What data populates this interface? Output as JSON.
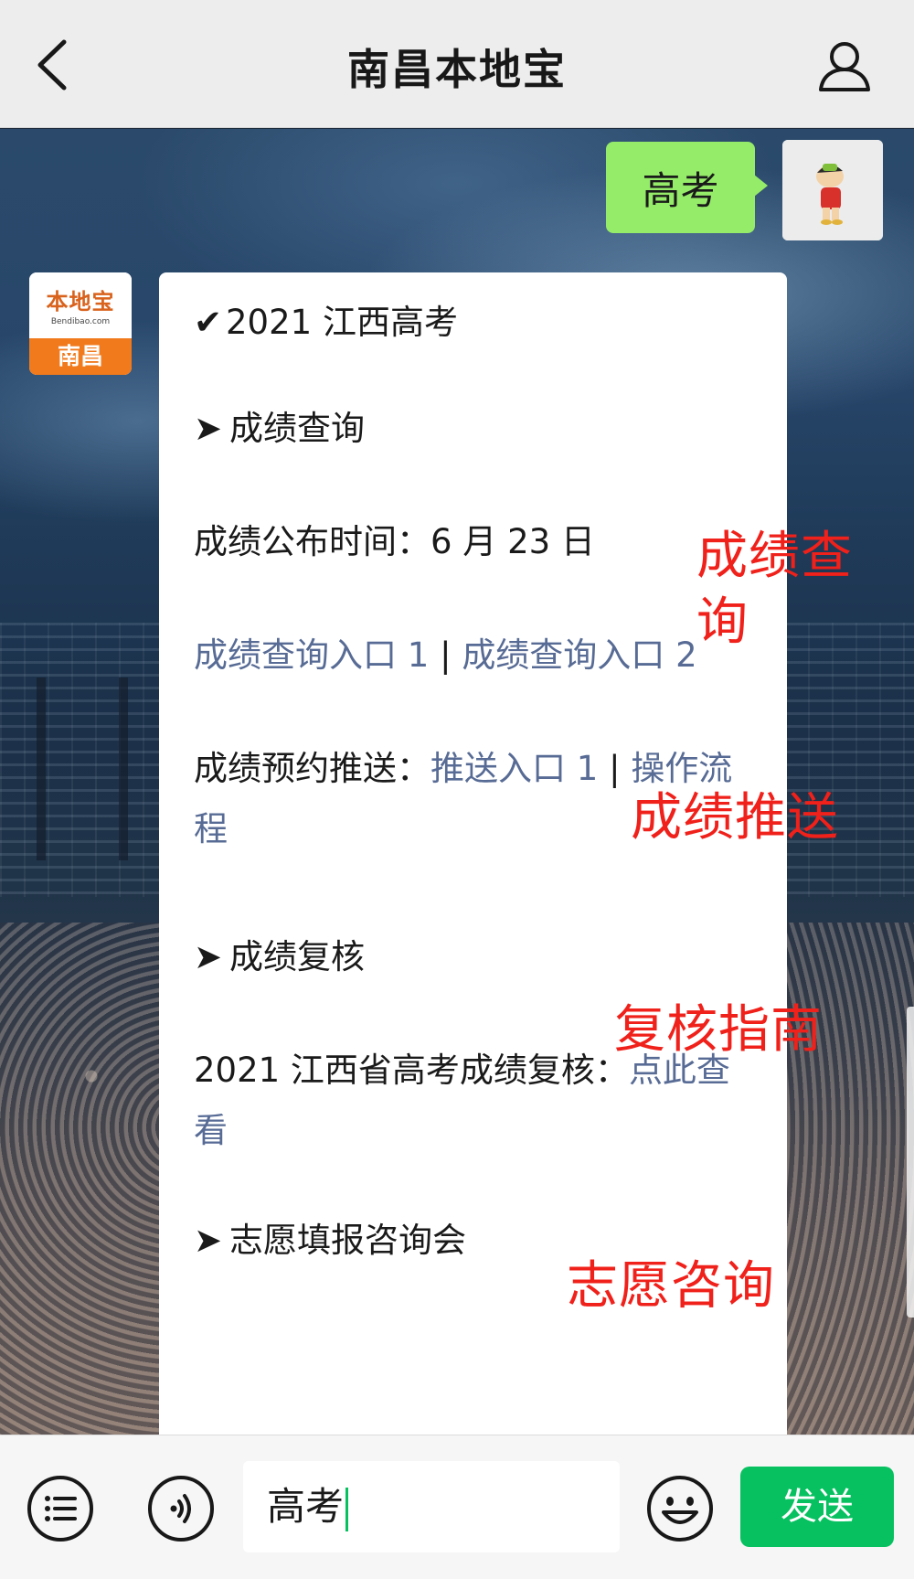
{
  "header": {
    "title": "南昌本地宝",
    "back_icon": "chevron-left-icon",
    "user_icon": "user-icon"
  },
  "sent_message": {
    "text": "高考"
  },
  "bot": {
    "logo_text": "本地宝",
    "logo_url": "Bendibao.com",
    "logo_city": "南昌"
  },
  "reply": {
    "headline": "2021 江西高考",
    "section1": {
      "title": "成绩查询",
      "release_label": "成绩公布时间：",
      "release_date": "6 月 23 日",
      "link1": "成绩查询入口 1",
      "sep1": " | ",
      "link2": "成绩查询入口 2",
      "push_label": "成绩预约推送：",
      "push_link": "推送入口 1",
      "sep2": " | ",
      "push_flow_link": "操作流程"
    },
    "section2": {
      "title": "成绩复核",
      "review_label": "2021 江西省高考成绩复核：",
      "review_link": "点此查看"
    },
    "section3": {
      "title": "志愿填报咨询会"
    }
  },
  "annotations": {
    "a1": "成绩查询",
    "a2": "成绩推送",
    "a3": "复核指南",
    "a4": "志愿咨询",
    "color": "#f0201a"
  },
  "input_bar": {
    "menu_icon": "list-icon",
    "voice_icon": "voice-icon",
    "input_value": "高考",
    "emoji_icon": "emoji-icon",
    "send_label": "发送",
    "send_color": "#07c160"
  },
  "colors": {
    "sent_bubble": "#95ec69",
    "link": "#576b95",
    "logo_orange": "#f07a1c"
  }
}
